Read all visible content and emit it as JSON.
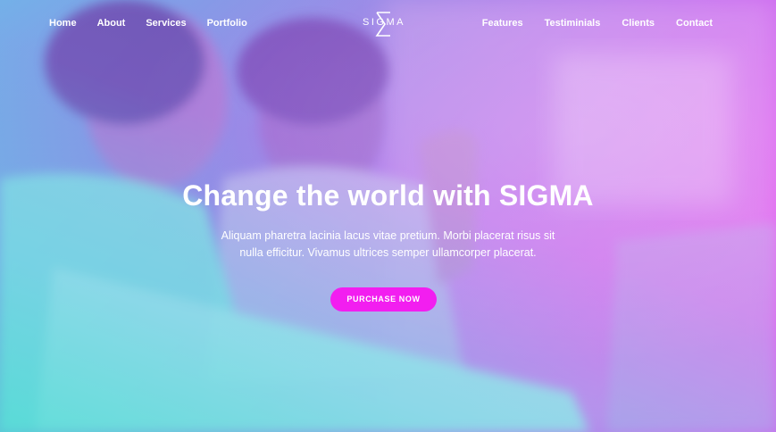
{
  "nav": {
    "left": [
      "Home",
      "About",
      "Services",
      "Portfolio"
    ],
    "right": [
      "Features",
      "Testiminials",
      "Clients",
      "Contact"
    ]
  },
  "logo": {
    "text": "SIGMA",
    "icon": "sigma-icon"
  },
  "hero": {
    "headline": "Change the world with SIGMA",
    "subtext": "Aliquam pharetra lacinia lacus vitae pretium. Morbi placerat risus sit nulla efficitur. Vivamus ultrices semper ullamcorper placerat.",
    "cta_label": "PURCHASE NOW"
  },
  "colors": {
    "accent": "#f21ef0",
    "gradient_start": "#4fdcd2",
    "gradient_end": "#f04ef2"
  }
}
